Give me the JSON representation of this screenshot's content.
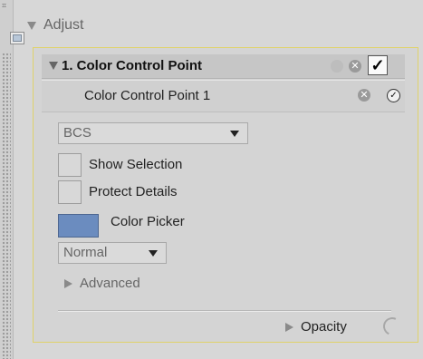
{
  "section": {
    "title": "Adjust"
  },
  "color_control_point": {
    "title": "1. Color Control Point",
    "checked": true,
    "item_label": "Color Control Point 1",
    "mode_dropdown": {
      "selected": "BCS"
    },
    "options": [
      {
        "label": "Show Selection",
        "checked": false
      },
      {
        "label": "Protect Details",
        "checked": false
      }
    ],
    "color_picker": {
      "label": "Color Picker",
      "color": "#6b8cbf"
    },
    "blend_dropdown": {
      "selected": "Normal"
    },
    "advanced_label": "Advanced",
    "opacity_label": "Opacity"
  },
  "icons": {
    "check": "✓",
    "close": "✕",
    "circle_check": "✓"
  },
  "colors": {
    "accent_border": "#e0d26a",
    "panel_bg": "#d4d4d4"
  }
}
